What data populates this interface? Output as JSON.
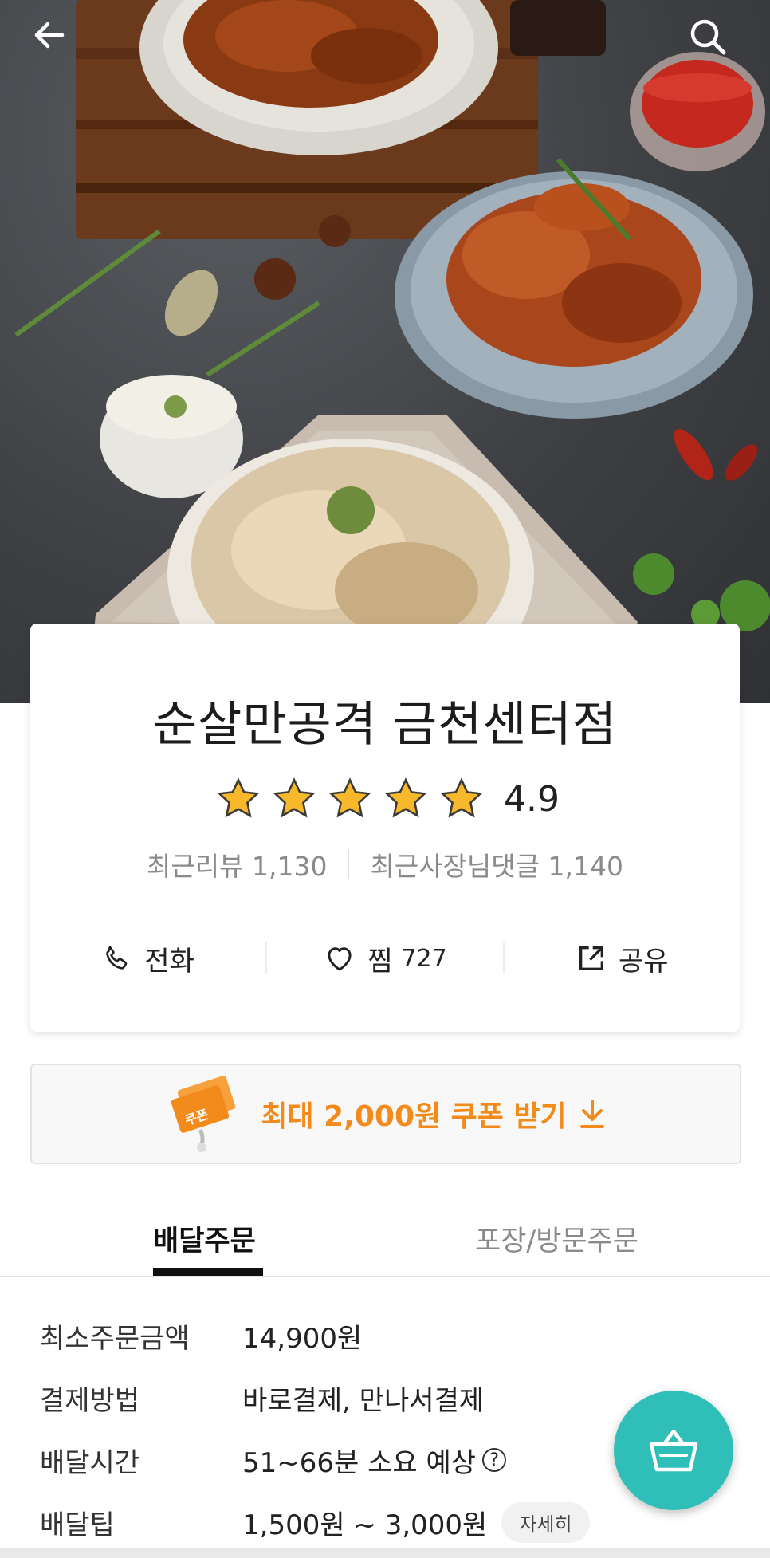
{
  "hero": {
    "alt": "순살만공격 금천센터점 치킨 메뉴 사진"
  },
  "store": {
    "name": "순살만공격 금천센터점",
    "rating": "4.9",
    "rating_stars": 5,
    "recent_reviews_label": "최근리뷰",
    "recent_reviews_count": "1,130",
    "owner_replies_label": "최근사장님댓글",
    "owner_replies_count": "1,140"
  },
  "actions": {
    "call_label": "전화",
    "like_label": "찜",
    "like_count": "727",
    "share_label": "공유"
  },
  "coupon": {
    "badge_text": "쿠폰",
    "label": "최대 2,000원 쿠폰 받기"
  },
  "tabs": [
    {
      "label": "배달주문",
      "active": true
    },
    {
      "label": "포장/방문주문",
      "active": false
    }
  ],
  "info": {
    "min_order_label": "최소주문금액",
    "min_order_value": "14,900원",
    "payment_label": "결제방법",
    "payment_value": "바로결제, 만나서결제",
    "time_label": "배달시간",
    "time_value": "51~66분 소요 예상",
    "tip_label": "배달팁",
    "tip_value": "1,500원 ~ 3,000원",
    "detail_button": "자세히"
  },
  "colors": {
    "accent_orange": "#f28a1c",
    "star_yellow": "#f7b92b",
    "fab_teal": "#2fbfb8"
  }
}
